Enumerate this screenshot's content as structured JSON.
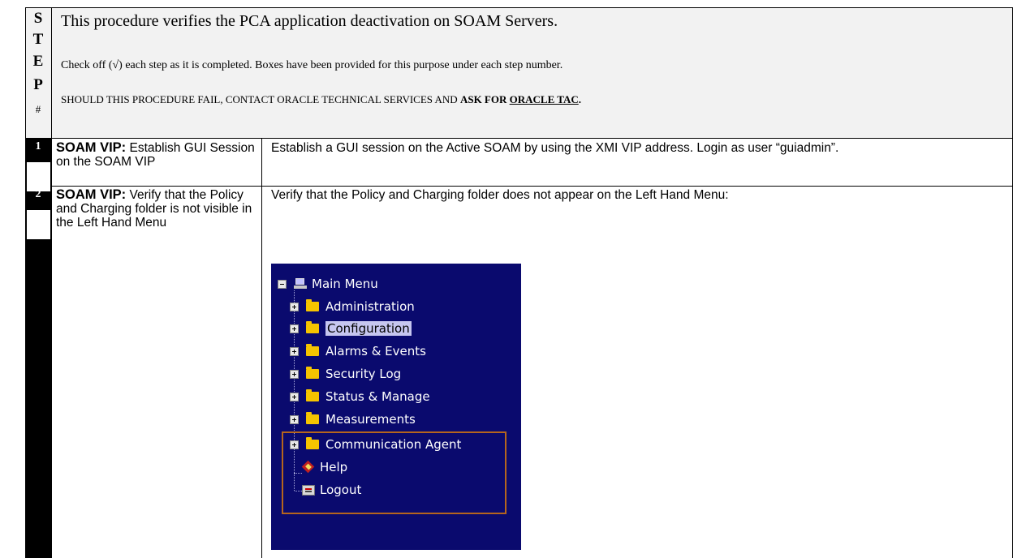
{
  "header": {
    "step_letters": [
      "S",
      "T",
      "E",
      "P",
      "#"
    ],
    "title": "This procedure verifies the PCA application deactivation on SOAM Servers.",
    "check_instruction": "Check off (√) each step as it is completed. Boxes have been provided for this purpose under each step number.",
    "fail_prefix": "SHOULD THIS PROCEDURE FAIL, CONTACT ORACLE TECHNICAL SERVICES AND ",
    "fail_ask": "ASK FOR ",
    "fail_tac": "ORACLE TAC",
    "fail_end": "."
  },
  "steps": [
    {
      "number": "1",
      "target_bold": "SOAM VIP:",
      "target_text": " Establish GUI Session on the SOAM VIP",
      "instruction": "Establish a GUI session on the Active SOAM by using the XMI VIP address. Login as user “guiadmin”."
    },
    {
      "number": "2",
      "target_bold": "SOAM VIP:",
      "target_text": " Verify that the Policy and Charging folder is not visible in the Left Hand Menu",
      "instruction": "Verify that the Policy and Charging folder does not appear on the Left Hand Menu:"
    }
  ],
  "menu": {
    "root": "Main Menu",
    "items": [
      {
        "label": "Administration",
        "icon": "folder-icon"
      },
      {
        "label": "Configuration",
        "icon": "folder-icon",
        "selected": true
      },
      {
        "label": "Alarms & Events",
        "icon": "folder-icon"
      },
      {
        "label": "Security Log",
        "icon": "folder-icon"
      },
      {
        "label": "Status & Manage",
        "icon": "folder-icon"
      },
      {
        "label": "Measurements",
        "icon": "folder-icon"
      },
      {
        "label": "Communication Agent",
        "icon": "folder-icon"
      },
      {
        "label": "Help",
        "icon": "help-icon"
      },
      {
        "label": "Logout",
        "icon": "logout-icon"
      }
    ]
  },
  "colors": {
    "menu_background": "#0a0a6e",
    "highlight_border": "#b5651d",
    "selected_background": "#c6c6f0"
  }
}
